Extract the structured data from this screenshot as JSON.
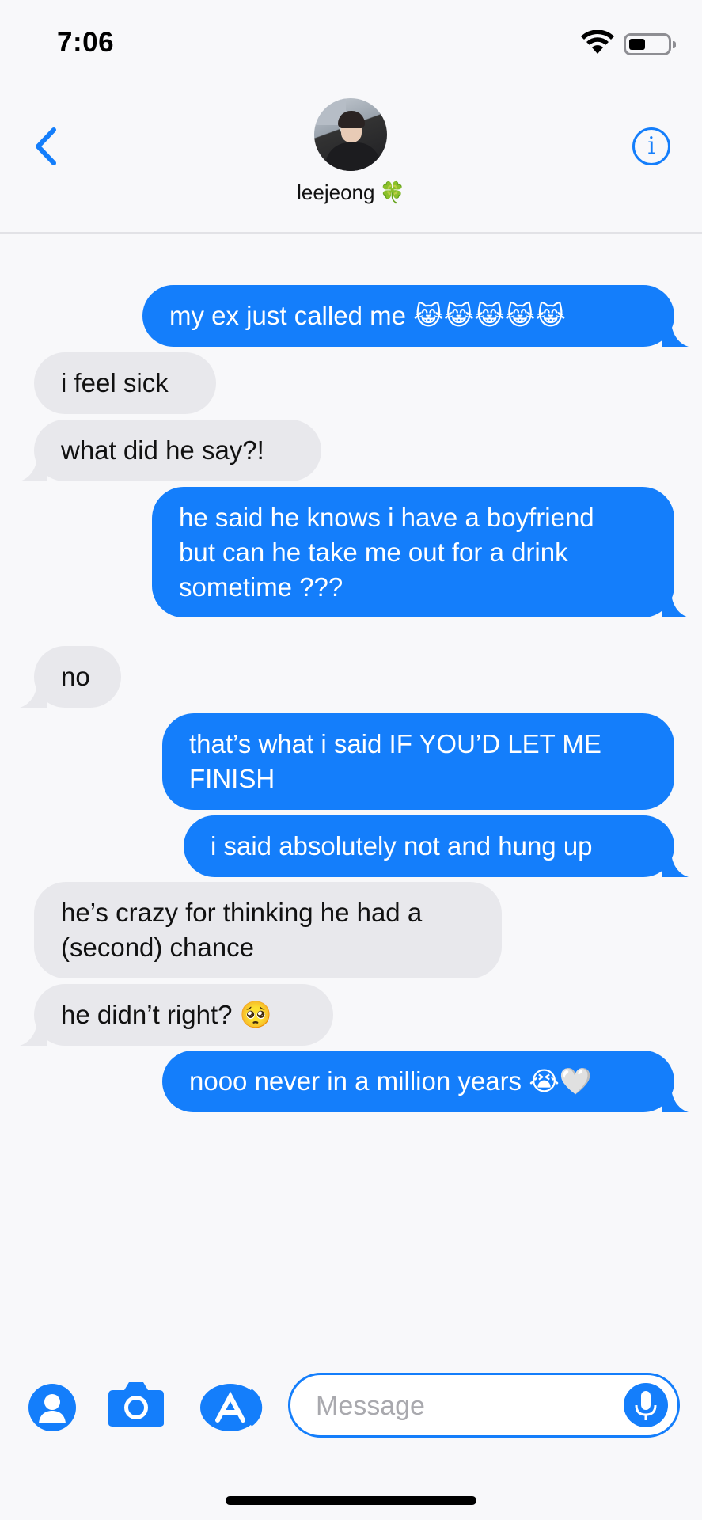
{
  "status": {
    "time": "7:06"
  },
  "header": {
    "contact_name": "leejeong",
    "contact_emoji": "🍀",
    "info_label": "i"
  },
  "messages": [
    {
      "side": "sent",
      "text": "my ex just called me 😹😹😹😹😹"
    },
    {
      "side": "received",
      "text": "i feel sick"
    },
    {
      "side": "received",
      "text": "what did he say?!"
    },
    {
      "side": "sent",
      "text": "he said he knows i have a boyfriend\nbut can he take me out for a drink\nsometime ???"
    },
    {
      "side": "received",
      "text": "no"
    },
    {
      "side": "sent",
      "text": "that’s what i said IF YOU’D LET ME\nFINISH"
    },
    {
      "side": "sent",
      "text": "i said absolutely not and hung up"
    },
    {
      "side": "received",
      "text": "he’s crazy for thinking he had a\n(second) chance"
    },
    {
      "side": "received",
      "text": "he didn’t right? 🥺"
    },
    {
      "side": "sent",
      "text": "nooo never in a million years 😭🤍"
    }
  ],
  "composer": {
    "placeholder": "Message"
  },
  "colors": {
    "accent": "#147efb",
    "received_bubble": "#e8e8ec",
    "background": "#f8f8fa"
  },
  "icons": [
    "contact-icon",
    "camera-icon",
    "app-store-icon",
    "microphone-icon",
    "wifi-icon",
    "battery-icon",
    "back-chevron-icon",
    "info-icon"
  ]
}
